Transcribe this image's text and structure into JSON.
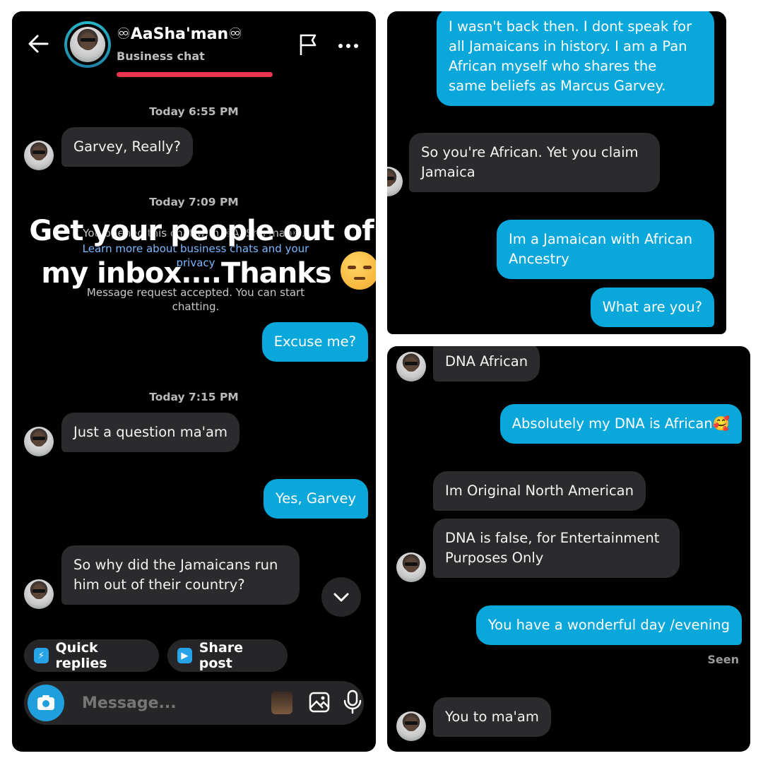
{
  "left": {
    "header": {
      "contact_name": "♾AaSha'man♾",
      "subtitle": "Business chat",
      "back_icon": "back-arrow-icon",
      "flag_icon": "flag-icon",
      "more_icon": "more-options-icon"
    },
    "timestamps": [
      "Today 6:55 PM",
      "Today 7:09 PM",
      "Today 7:15 PM"
    ],
    "system": {
      "opened_chat": "You opened this chat with ♾AaSha'man♾.",
      "learn_more": "Learn more about business chats and your privacy",
      "accepted": "Message request accepted. You can start chatting."
    },
    "overlay_text": {
      "line1": "Get your people out of",
      "line2": "my inbox....Thanks"
    },
    "messages": [
      {
        "from": "them",
        "text": "Garvey, Really?"
      },
      {
        "from": "me",
        "text": "Excuse me?"
      },
      {
        "from": "them",
        "text": "Just a question ma'am"
      },
      {
        "from": "me",
        "text": "Yes, Garvey"
      },
      {
        "from": "them",
        "text": "So why did the Jamaicans run\nhim out of their country?"
      }
    ],
    "quick_replies": "Quick replies",
    "share_post": "Share post",
    "composer_placeholder": "Message..."
  },
  "top_right": {
    "messages": [
      {
        "from": "me",
        "text": "I wasn't back then. I dont speak for\nall Jamaicans in history. I am a Pan\nAfrican myself who shares the\nsame beliefs as Marcus Garvey."
      },
      {
        "from": "them",
        "text": "So you're African. Yet you claim\nJamaica"
      },
      {
        "from": "me",
        "text": "Im a Jamaican with African\nAncestry"
      },
      {
        "from": "me",
        "text": "What are you?"
      }
    ]
  },
  "bottom_right": {
    "messages": [
      {
        "from": "them",
        "text": "DNA African"
      },
      {
        "from": "me",
        "text": "Absolutely my DNA is African🥰"
      },
      {
        "from": "them",
        "text": "Im Original North American"
      },
      {
        "from": "them",
        "text": "DNA is false, for Entertainment\nPurposes Only"
      },
      {
        "from": "me",
        "text": "You have a wonderful day /evening"
      },
      {
        "from": "them",
        "text": "You to ma'am"
      }
    ],
    "seen_label": "Seen"
  },
  "colors": {
    "outgoing_bubble": "#0aa7db",
    "incoming_bubble": "#2b2b2d",
    "background": "#000000"
  }
}
